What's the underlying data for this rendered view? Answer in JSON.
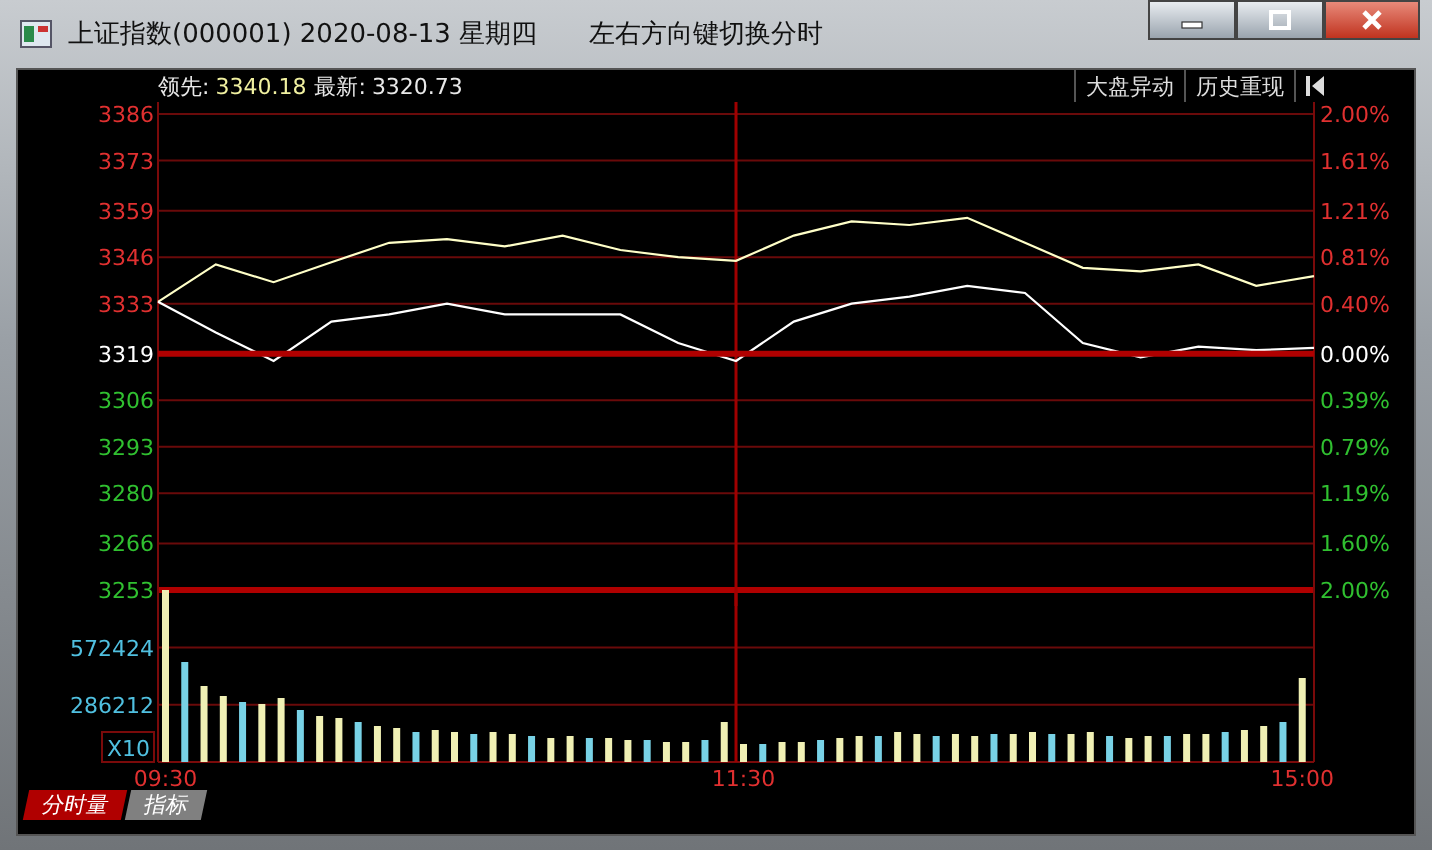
{
  "window": {
    "title": "上证指数(000001) 2020-08-13 星期四",
    "hint": "左右方向键切换分时"
  },
  "header": {
    "items": [
      {
        "label": "领先:",
        "value": "3340.18"
      },
      {
        "label": "最新:",
        "value": "3320.73"
      }
    ],
    "buttons": [
      "大盘异动",
      "历史重现"
    ]
  },
  "price_panel": {
    "chart_data": {
      "type": "line",
      "categories": [
        null,
        null,
        null,
        null,
        null,
        null,
        null,
        null,
        null,
        null,
        null,
        null,
        null,
        null,
        null,
        null,
        null,
        null,
        null,
        null,
        null
      ],
      "ylim": [
        3253,
        3386
      ],
      "grid": true,
      "yticks": [
        3386,
        3373,
        3359,
        3346,
        3333,
        3319,
        3306,
        3293,
        3280,
        3266,
        3253
      ],
      "series": [
        {
          "color": "#ffffc8",
          "values": [
            3333.5,
            3344,
            3339,
            3344.6,
            3350,
            3351,
            3349,
            3352,
            3348,
            3346,
            3345,
            3352,
            3356,
            3355,
            3357,
            3350,
            3343,
            3342,
            3344,
            3338,
            3340.7
          ]
        },
        {
          "color": "#ffffff",
          "values": [
            3333.5,
            3325,
            3317,
            3328,
            3330,
            3333,
            3330,
            3330,
            3330,
            3322,
            3317,
            3328,
            3333,
            3335,
            3338,
            3336,
            3322,
            3318,
            3321,
            3320,
            3320.7
          ]
        },
        {
          "color": "#b00000",
          "values": [
            3319,
            3319,
            3319,
            3319,
            3319,
            3319,
            3319,
            3319,
            3319,
            3319,
            3319,
            3319,
            3319,
            3319,
            3319,
            3319,
            3319,
            3319,
            3319,
            3319,
            3319
          ]
        }
      ]
    },
    "percent_labels": [
      "2.00%",
      "1.61%",
      "1.21%",
      "0.81%",
      "0.40%",
      "0.00%",
      "0.39%",
      "0.79%",
      "1.19%",
      "1.60%",
      "2.00%"
    ]
  },
  "volume_panel": {
    "chart_data": {
      "type": "bar",
      "stacked": true,
      "ylabel": "X10",
      "ylim": [
        0,
        860000
      ],
      "grid": true,
      "yticks": [
        286212,
        572424
      ],
      "categories": [
        "09:30",
        null,
        null,
        null,
        null,
        null,
        null,
        null,
        null,
        null,
        null,
        null,
        null,
        null,
        null,
        null,
        null,
        null,
        null,
        null,
        null,
        null,
        null,
        null,
        null,
        null,
        null,
        null,
        null,
        null,
        "11:30",
        null,
        null,
        null,
        null,
        null,
        null,
        null,
        null,
        null,
        null,
        null,
        null,
        null,
        null,
        null,
        null,
        null,
        null,
        null,
        null,
        null,
        null,
        null,
        null,
        null,
        null,
        null,
        null,
        "15:00"
      ],
      "series": [
        {
          "color": "#f0f0b4",
          "values": [
            860000,
            null,
            380000,
            330000,
            null,
            290000,
            320000,
            null,
            230000,
            220000,
            null,
            180000,
            170000,
            null,
            160000,
            150000,
            null,
            150000,
            140000,
            null,
            120000,
            130000,
            null,
            120000,
            110000,
            null,
            100000,
            100000,
            null,
            200000,
            90000,
            null,
            100000,
            100000,
            null,
            120000,
            130000,
            null,
            150000,
            140000,
            null,
            140000,
            130000,
            null,
            140000,
            150000,
            null,
            140000,
            150000,
            null,
            120000,
            130000,
            null,
            140000,
            140000,
            null,
            160000,
            180000,
            null,
            420000
          ]
        },
        {
          "color": "#78d2e6",
          "values": [
            null,
            500000,
            null,
            null,
            300000,
            null,
            null,
            260000,
            null,
            null,
            200000,
            null,
            null,
            150000,
            null,
            null,
            140000,
            null,
            null,
            130000,
            null,
            null,
            120000,
            null,
            null,
            110000,
            null,
            null,
            110000,
            null,
            null,
            90000,
            null,
            null,
            110000,
            null,
            null,
            130000,
            null,
            null,
            130000,
            null,
            null,
            140000,
            null,
            null,
            140000,
            null,
            null,
            130000,
            null,
            null,
            130000,
            null,
            null,
            150000,
            null,
            null,
            200000,
            null
          ]
        }
      ]
    }
  },
  "tabs": [
    {
      "label": "分时量",
      "selected": true
    },
    {
      "label": "指标",
      "selected": false
    }
  ]
}
